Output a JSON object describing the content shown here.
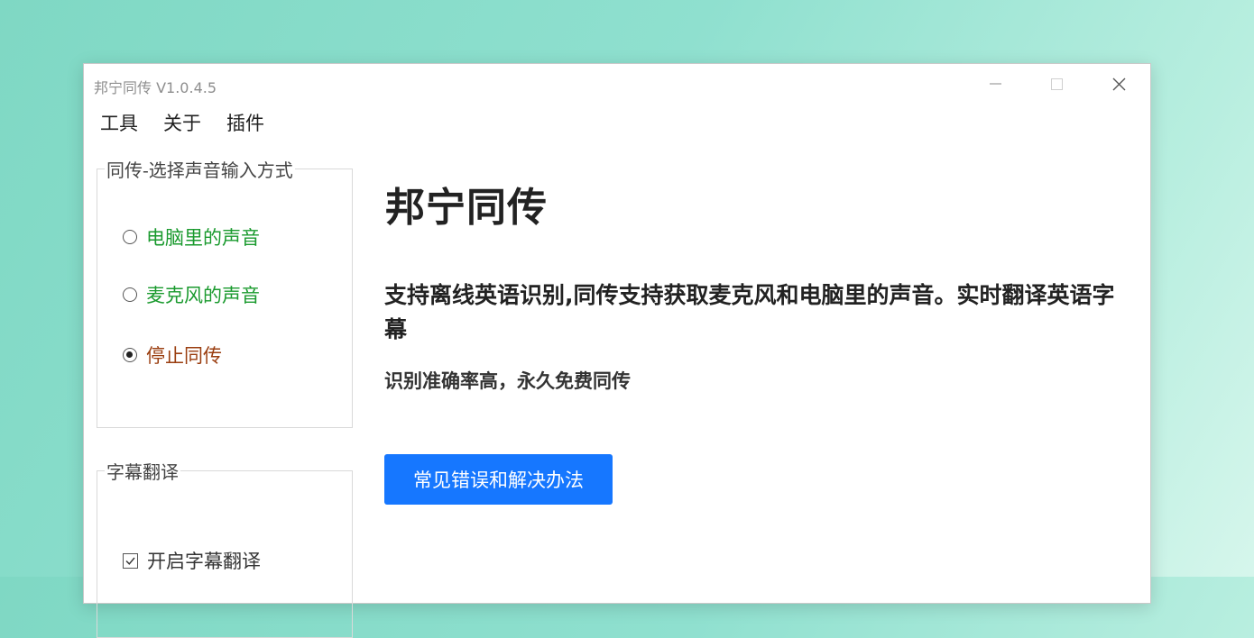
{
  "window": {
    "title": "邦宁同传 V1.0.4.5"
  },
  "menu": [
    "工具",
    "关于",
    "插件"
  ],
  "input_group": {
    "legend": "同传-选择声音输入方式",
    "options": [
      {
        "label": "电脑里的声音",
        "selected": false,
        "color": "#1a9a2e"
      },
      {
        "label": "麦克风的声音",
        "selected": false,
        "color": "#1a9a2e"
      },
      {
        "label": "停止同传",
        "selected": true,
        "color": "#9a3d0f"
      }
    ]
  },
  "subtitle_group": {
    "legend": "字幕翻译",
    "checkbox_label": "开启字幕翻译",
    "checked": true
  },
  "main": {
    "heading": "邦宁同传",
    "description": "支持离线英语识别,同传支持获取麦克风和电脑里的声音。实时翻译英语字幕",
    "subdescription": "识别准确率高，永久免费同传",
    "faq_button": "常见错误和解决办法"
  },
  "colors": {
    "accent": "#1677ff"
  }
}
